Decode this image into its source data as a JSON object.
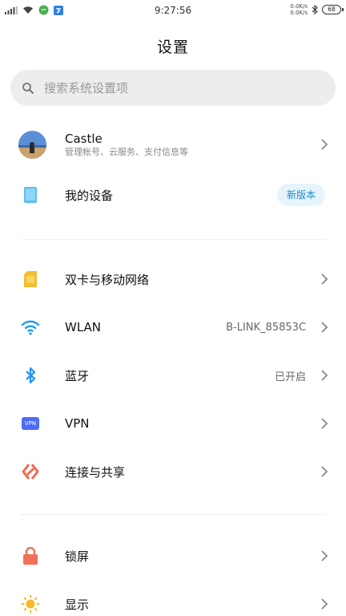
{
  "status_bar": {
    "time": "9:27:56",
    "up_speed": "0.0K/s",
    "down_speed": "0.0K/s",
    "battery": "68"
  },
  "header": {
    "title": "设置"
  },
  "search": {
    "placeholder": "搜索系统设置项"
  },
  "account": {
    "name": "Castle",
    "subtitle": "管理帐号、云服务、支付信息等"
  },
  "device": {
    "label": "我的设备",
    "badge": "新版本"
  },
  "network": {
    "sim": {
      "label": "双卡与移动网络"
    },
    "wlan": {
      "label": "WLAN",
      "value": "B-LINK_85853C"
    },
    "bluetooth": {
      "label": "蓝牙",
      "value": "已开启"
    },
    "vpn": {
      "label": "VPN",
      "icon_text": "VPN"
    },
    "share": {
      "label": "连接与共享"
    }
  },
  "display_group": {
    "lock": {
      "label": "锁屏"
    },
    "display": {
      "label": "显示"
    }
  },
  "colors": {
    "accent_blue": "#2196f3",
    "sim_yellow": "#f4bd2c",
    "vpn_blue": "#4a6cf7",
    "share_red": "#f06a4f",
    "lock_red": "#f0705a",
    "sun_yellow": "#f6b82a"
  }
}
